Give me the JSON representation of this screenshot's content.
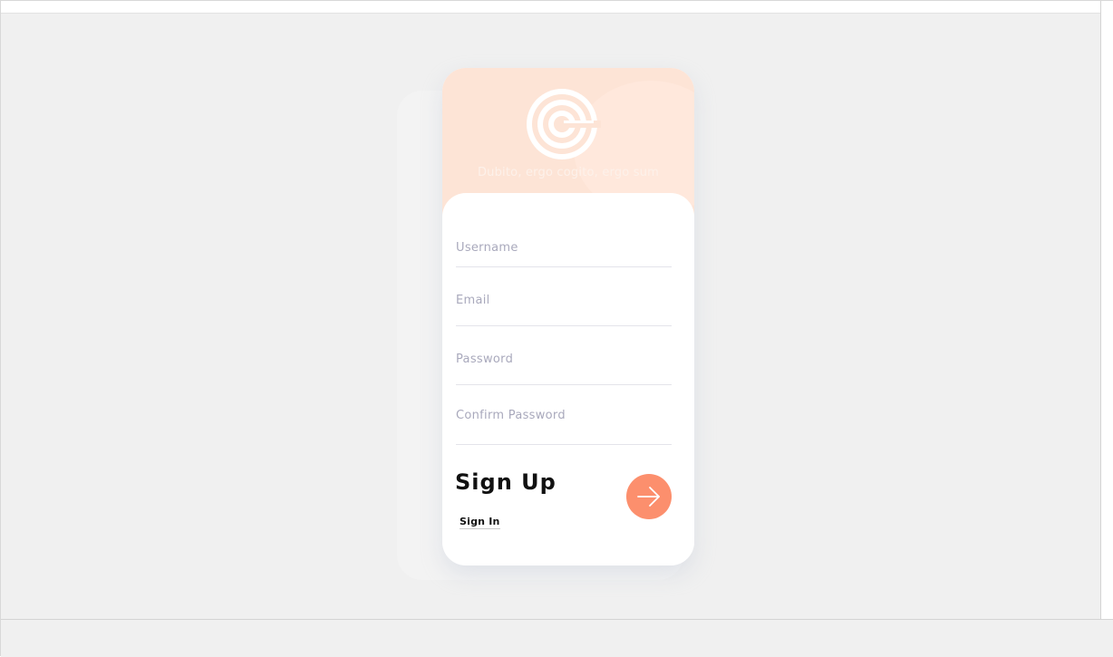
{
  "header": {
    "logo_icon": "concentric-c-logo-icon",
    "tagline": "Dubito, ergo cogito, ergo sum"
  },
  "form": {
    "username": {
      "value": "",
      "placeholder": "Username"
    },
    "email": {
      "value": "",
      "placeholder": "Email"
    },
    "password": {
      "value": "",
      "placeholder": "Password"
    },
    "confirm_password": {
      "value": "",
      "placeholder": "Confirm Password"
    },
    "title": "Sign Up",
    "submit_icon": "arrow-right-icon",
    "signin_label": "Sign In"
  },
  "colors": {
    "header_background": "#fde4d6",
    "accent": "#fc8f6d",
    "page_background": "#f0f0f0",
    "card_background": "#ffffff"
  }
}
